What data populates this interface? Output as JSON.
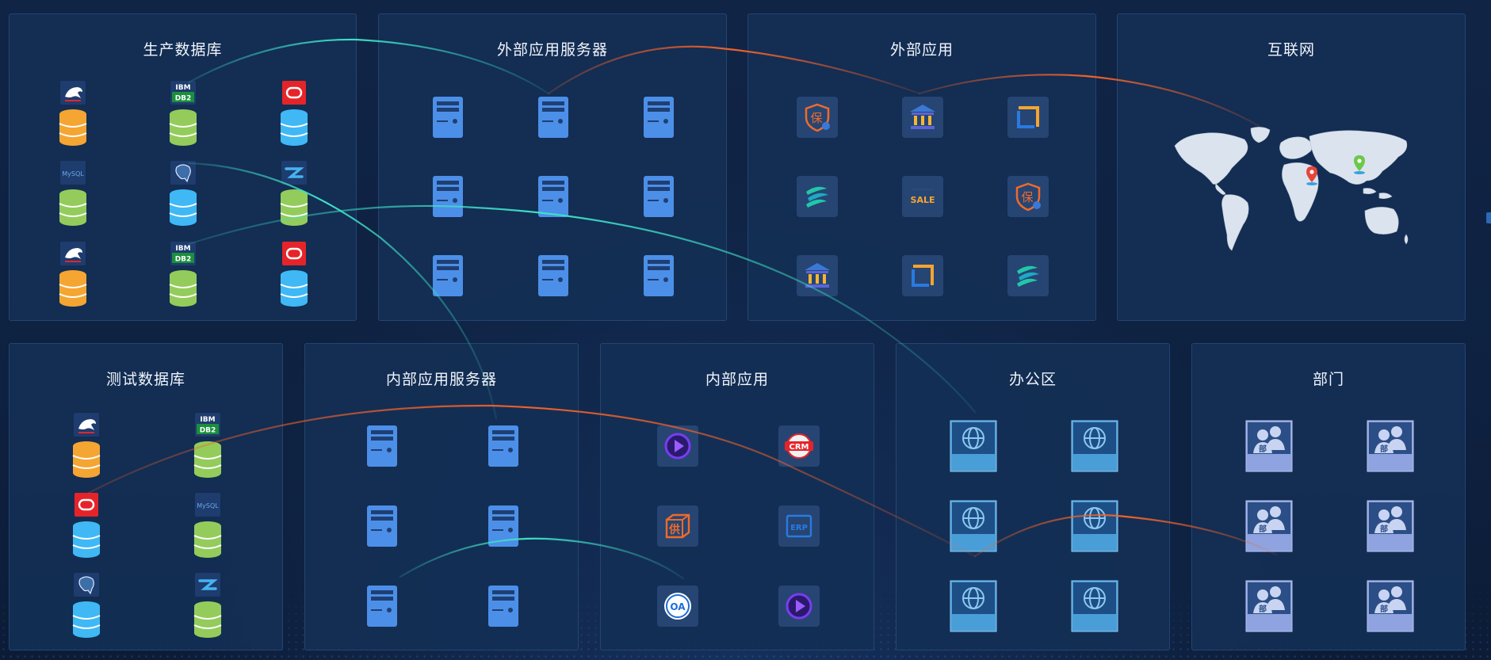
{
  "panels": {
    "prod_db": {
      "title": "生产数据库"
    },
    "ext_servers": {
      "title": "外部应用服务器"
    },
    "ext_apps": {
      "title": "外部应用"
    },
    "internet": {
      "title": "互联网"
    },
    "test_db": {
      "title": "测试数据库"
    },
    "int_servers": {
      "title": "内部应用服务器"
    },
    "int_apps": {
      "title": "内部应用"
    },
    "office": {
      "title": "办公区"
    },
    "dept": {
      "title": "部门"
    }
  },
  "labels": {
    "ibm": "IBM",
    "db2": "DB2",
    "mysql": "MySQL",
    "sale": "SALE",
    "crm": "CRM",
    "erp": "ERP",
    "oa": "OA",
    "supply": "供",
    "baoxian": "保",
    "bumen": "部"
  },
  "colors": {
    "teal_link": "#3fe0c8",
    "orange_link": "#f0622a",
    "server_blue": "#4c8fe8",
    "db_orange": "#f5a531",
    "db_green": "#93cc5b",
    "db_blue": "#3fb8f5",
    "oracle_red": "#e5242a"
  },
  "icons": {
    "prod_db": [
      "mysql-dolphin-db-icon",
      "ibm-db2-db-icon",
      "oracle-db-icon",
      "mysql-db-icon",
      "postgresql-db-icon",
      "sql-db-icon",
      "mysql-dolphin-db-icon",
      "ibm-db2-db-icon",
      "oracle-db-icon"
    ],
    "test_db": [
      "mysql-dolphin-db-icon",
      "ibm-db2-db-icon",
      "oracle-db-icon",
      "mysql-db-icon",
      "postgresql-db-icon",
      "sql-db-icon"
    ],
    "ext_apps": [
      "insurance-icon",
      "bank-icon",
      "frame-app-icon",
      "stripes-app-icon",
      "sale-icon",
      "insurance-icon",
      "bank-icon",
      "frame-app-icon",
      "stripes-app-icon"
    ],
    "int_apps": [
      "play-app-icon",
      "crm-icon",
      "supply-icon",
      "erp-icon",
      "oa-icon",
      "play-app-icon"
    ]
  }
}
